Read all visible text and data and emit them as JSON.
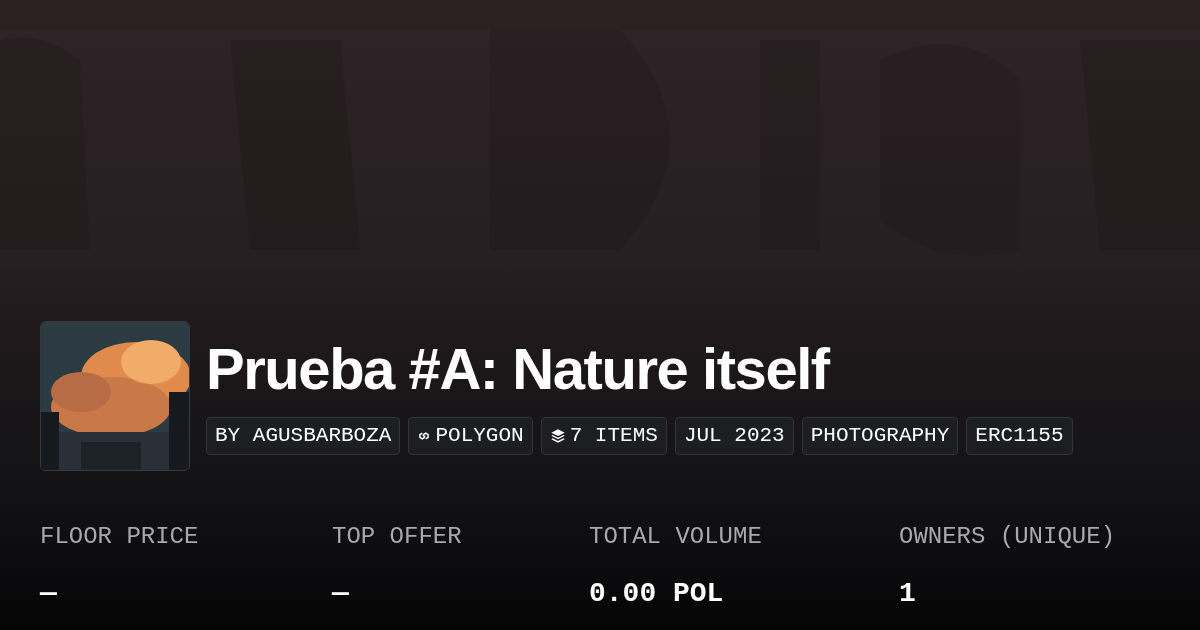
{
  "collection": {
    "title": "Prueba #A: Nature itself",
    "tags": [
      {
        "kind": "text",
        "label": "BY AGUSBARBOZA"
      },
      {
        "kind": "chain",
        "label": "POLYGON"
      },
      {
        "kind": "items",
        "label": "7 ITEMS"
      },
      {
        "kind": "text",
        "label": "JUL 2023"
      },
      {
        "kind": "text",
        "label": "PHOTOGRAPHY"
      },
      {
        "kind": "text",
        "label": "ERC1155"
      }
    ]
  },
  "stats": [
    {
      "label": "FLOOR PRICE",
      "value": "—"
    },
    {
      "label": "TOP OFFER",
      "value": "—"
    },
    {
      "label": "TOTAL VOLUME",
      "value": "0.00 POL"
    },
    {
      "label": "OWNERS (UNIQUE)",
      "value": "1"
    }
  ]
}
